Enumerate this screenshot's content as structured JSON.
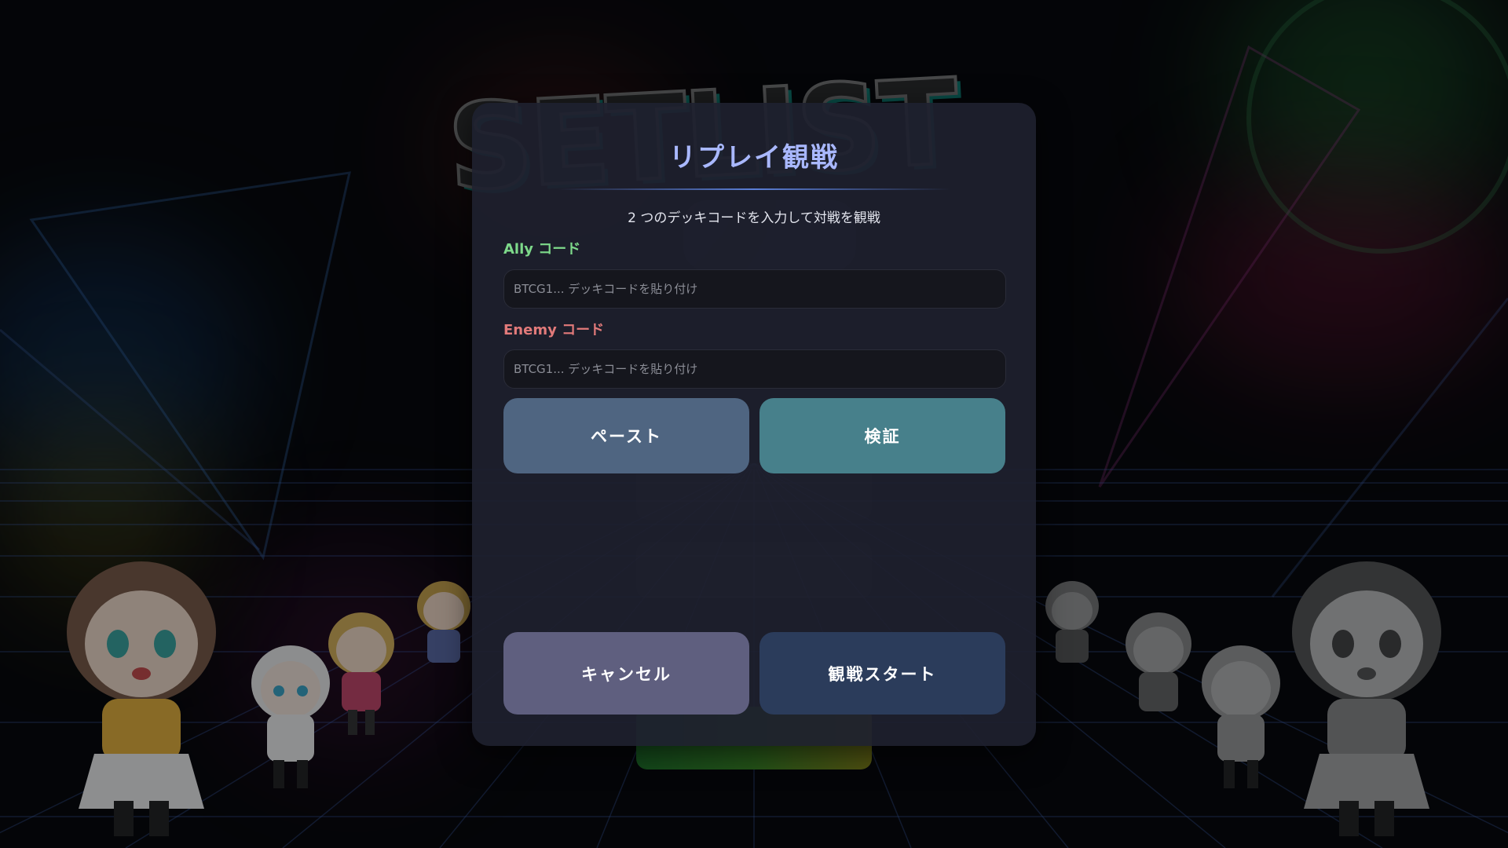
{
  "modal": {
    "title": "リプレイ観戦",
    "subtitle": "2 つのデッキコードを入力して対戦を観戦",
    "ally_label": "Ally コード",
    "ally_placeholder": "BTCG1... デッキコードを貼り付け",
    "enemy_label": "Enemy コード",
    "enemy_placeholder": "BTCG1... デッキコードを貼り付け",
    "paste_button": "ペースト",
    "verify_button": "検証",
    "cancel_button": "キャンセル",
    "start_button": "観戦スタート"
  },
  "colors": {
    "title": "#a9b8ff",
    "ally_label": "#7dd98a",
    "enemy_label": "#e27a7a",
    "paste_button": "#4f6581",
    "verify_button": "#47808b",
    "cancel_button": "#5f5f7f",
    "start_button": "#2b3c5b",
    "modal_bg": "#1e202e"
  }
}
